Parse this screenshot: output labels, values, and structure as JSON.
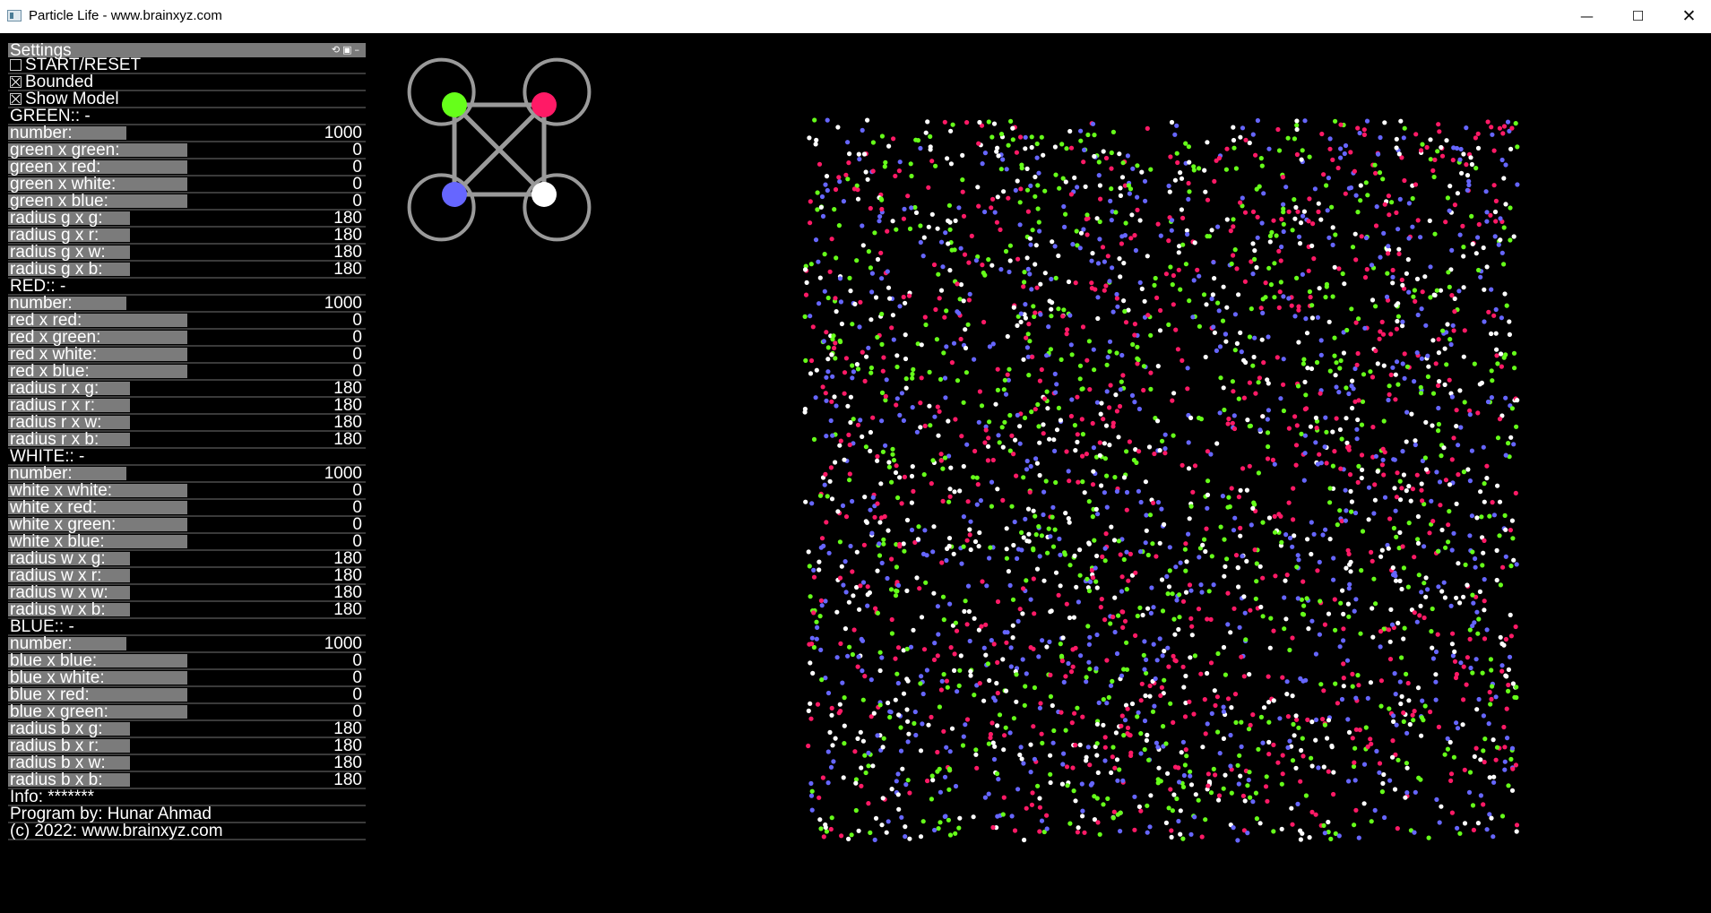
{
  "window": {
    "title": "Particle Life - www.brainxyz.com",
    "icon": "app-window-icon",
    "minimize": "—",
    "maximize": "☐",
    "close": "✕"
  },
  "settings": {
    "header": "Settings",
    "header_icons": "⟲▣–",
    "start_reset": {
      "label": "START/RESET",
      "checked": false
    },
    "bounded": {
      "label": "Bounded",
      "checked": true
    },
    "show_model": {
      "label": "Show Model",
      "checked": true
    },
    "groups": [
      {
        "key": "green",
        "header": "GREEN:: -",
        "number": {
          "label": "number:",
          "value": "1000",
          "fraction": 0.33
        },
        "interactions": [
          {
            "label": "green x green:",
            "value": "0"
          },
          {
            "label": "green x red:",
            "value": "0"
          },
          {
            "label": "green x white:",
            "value": "0"
          },
          {
            "label": "green x blue:",
            "value": "0"
          }
        ],
        "radii": [
          {
            "label": "radius g x g:",
            "value": "180"
          },
          {
            "label": "radius g x r:",
            "value": "180"
          },
          {
            "label": "radius g x w:",
            "value": "180"
          },
          {
            "label": "radius g x b:",
            "value": "180"
          }
        ]
      },
      {
        "key": "red",
        "header": "RED:: -",
        "number": {
          "label": "number:",
          "value": "1000",
          "fraction": 0.33
        },
        "interactions": [
          {
            "label": "red x red:",
            "value": "0"
          },
          {
            "label": "red x green:",
            "value": "0"
          },
          {
            "label": "red x white:",
            "value": "0"
          },
          {
            "label": "red x blue:",
            "value": "0"
          }
        ],
        "radii": [
          {
            "label": "radius r x g:",
            "value": "180"
          },
          {
            "label": "radius r x r:",
            "value": "180"
          },
          {
            "label": "radius r x w:",
            "value": "180"
          },
          {
            "label": "radius r x b:",
            "value": "180"
          }
        ]
      },
      {
        "key": "white",
        "header": "WHITE:: -",
        "number": {
          "label": "number:",
          "value": "1000",
          "fraction": 0.33
        },
        "interactions": [
          {
            "label": "white x white:",
            "value": "0"
          },
          {
            "label": "white x red:",
            "value": "0"
          },
          {
            "label": "white x green:",
            "value": "0"
          },
          {
            "label": "white x blue:",
            "value": "0"
          }
        ],
        "radii": [
          {
            "label": "radius w x g:",
            "value": "180"
          },
          {
            "label": "radius w x r:",
            "value": "180"
          },
          {
            "label": "radius w x w:",
            "value": "180"
          },
          {
            "label": "radius w x b:",
            "value": "180"
          }
        ]
      },
      {
        "key": "blue",
        "header": "BLUE:: -",
        "number": {
          "label": "number:",
          "value": "1000",
          "fraction": 0.33
        },
        "interactions": [
          {
            "label": "blue x blue:",
            "value": "0"
          },
          {
            "label": "blue x white:",
            "value": "0"
          },
          {
            "label": "blue x red:",
            "value": "0"
          },
          {
            "label": "blue x green:",
            "value": "0"
          }
        ],
        "radii": [
          {
            "label": "radius b x g:",
            "value": "180"
          },
          {
            "label": "radius b x r:",
            "value": "180"
          },
          {
            "label": "radius b x w:",
            "value": "180"
          },
          {
            "label": "radius b x b:",
            "value": "180"
          }
        ]
      }
    ],
    "interaction_fraction": 0.5,
    "radius_fraction": 0.34,
    "info": "Info: *******",
    "author": "Program by: Hunar Ahmad",
    "copyright": "(c) 2022: www.brainxyz.com"
  },
  "colors": {
    "green": "#66ff1a",
    "red": "#ff1a66",
    "white": "#ffffff",
    "blue": "#6666ff",
    "model_ring": "#9a9a9a",
    "slider_fill": "#7b7b7b"
  }
}
